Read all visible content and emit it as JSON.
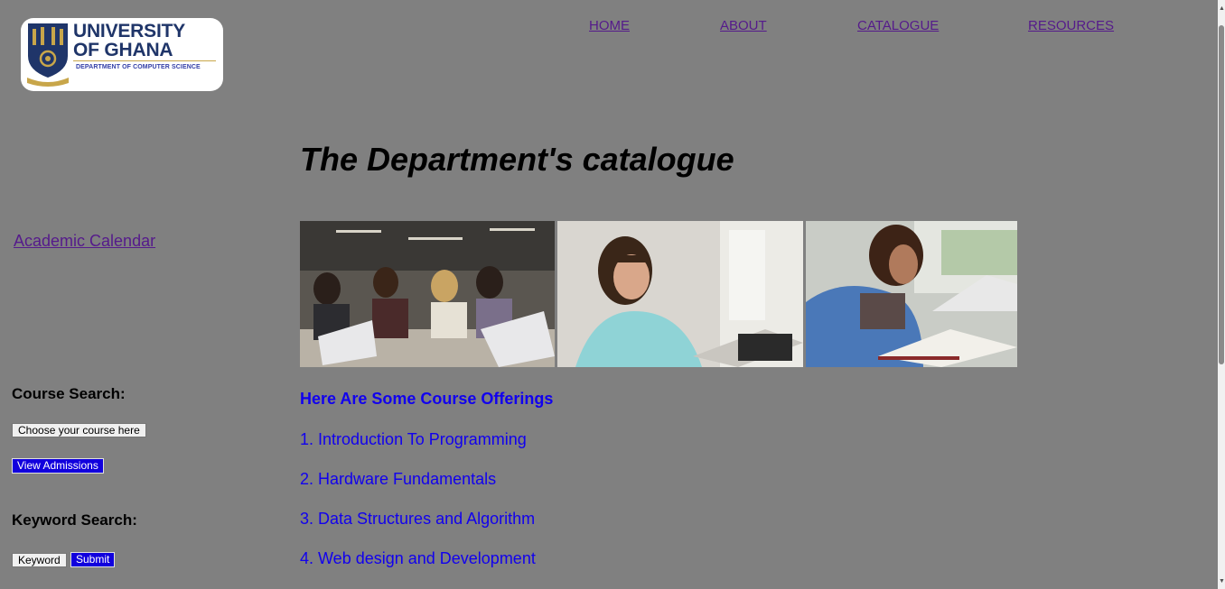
{
  "logo": {
    "line1": "UNIVERSITY",
    "line2": "OF GHANA",
    "dept": "DEPARTMENT OF COMPUTER SCIENCE",
    "navy": "#1f3569",
    "gold": "#c8a64a"
  },
  "nav": {
    "items": [
      {
        "label": "HOME"
      },
      {
        "label": "ABOUT"
      },
      {
        "label": "CATALOGUE"
      },
      {
        "label": "RESOURCES"
      }
    ]
  },
  "page_title": "The Department's catalogue",
  "sidebar": {
    "calendar_link": "Academic Calendar",
    "course_search_label": "Course Search:",
    "course_select_value": "Choose your course here",
    "view_admissions_label": "View Admissions",
    "keyword_search_label": "Keyword Search:",
    "keyword_button_label": "Keyword",
    "submit_label": "Submit"
  },
  "courses": {
    "heading": "Here Are Some Course Offerings",
    "items": [
      "1. Introduction To Programming",
      "2. Hardware Fundamentals",
      "3. Data Structures and Algorithm",
      "4. Web design and Development"
    ]
  },
  "colors": {
    "background": "#808080",
    "link_visited": "#551a8b",
    "course_blue": "#1100ee",
    "button_blue": "#1100dd"
  }
}
